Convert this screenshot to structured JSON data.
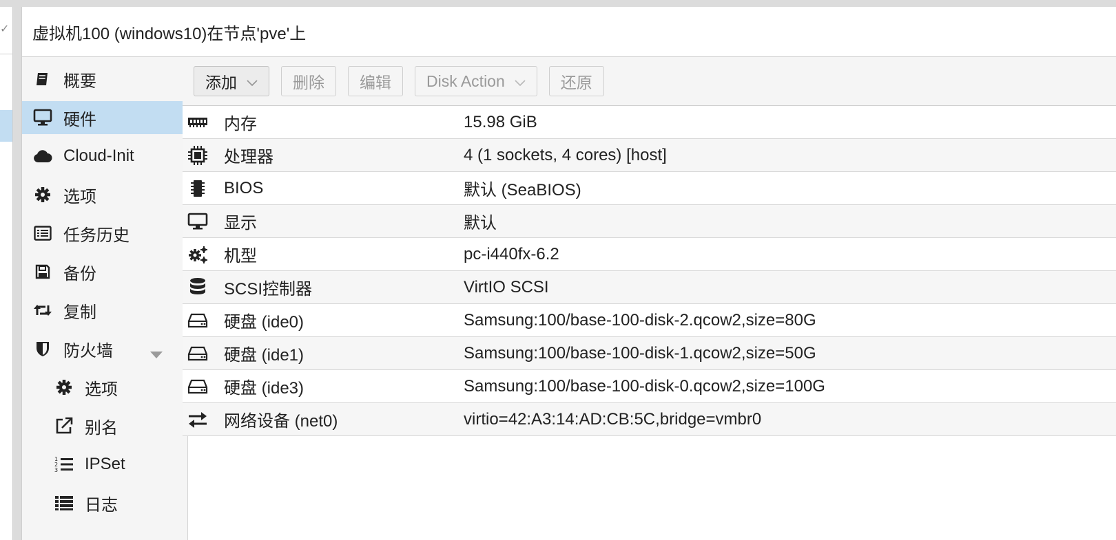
{
  "panel": {
    "title": "虚拟机100 (windows10)在节点'pve'上"
  },
  "nav": {
    "items": [
      {
        "label": "概要",
        "icon": "book-icon"
      },
      {
        "label": "硬件",
        "icon": "desktop-icon",
        "selected": true
      },
      {
        "label": "Cloud-Init",
        "icon": "cloud-icon"
      },
      {
        "label": "选项",
        "icon": "gear-icon"
      },
      {
        "label": "任务历史",
        "icon": "list-alt-icon"
      },
      {
        "label": "备份",
        "icon": "floppy-icon"
      },
      {
        "label": "复制",
        "icon": "retweet-icon"
      },
      {
        "label": "防火墙",
        "icon": "shield-icon",
        "expandable": true
      },
      {
        "label": "选项",
        "icon": "gear-icon",
        "sub": true
      },
      {
        "label": "别名",
        "icon": "external-link-icon",
        "sub": true
      },
      {
        "label": "IPSet",
        "icon": "list-ol-icon",
        "sub": true
      },
      {
        "label": "日志",
        "icon": "list-icon",
        "sub": true
      }
    ]
  },
  "toolbar": {
    "add_label": "添加",
    "remove_label": "删除",
    "edit_label": "编辑",
    "disk_action_label": "Disk Action",
    "revert_label": "还原"
  },
  "hardware": {
    "rows": [
      {
        "name": "内存",
        "value": "15.98 GiB",
        "icon": "memory-icon"
      },
      {
        "name": "处理器",
        "value": "4 (1 sockets, 4 cores) [host]",
        "icon": "cpu-icon"
      },
      {
        "name": "BIOS",
        "value": "默认 (SeaBIOS)",
        "icon": "microchip-icon"
      },
      {
        "name": "显示",
        "value": "默认",
        "icon": "desktop-icon"
      },
      {
        "name": "机型",
        "value": "pc-i440fx-6.2",
        "icon": "cogs-icon"
      },
      {
        "name": "SCSI控制器",
        "value": "VirtIO SCSI",
        "icon": "database-icon"
      },
      {
        "name": "硬盘 (ide0)",
        "value": "Samsung:100/base-100-disk-2.qcow2,size=80G",
        "icon": "hdd-icon"
      },
      {
        "name": "硬盘 (ide1)",
        "value": "Samsung:100/base-100-disk-1.qcow2,size=50G",
        "icon": "hdd-icon"
      },
      {
        "name": "硬盘 (ide3)",
        "value": "Samsung:100/base-100-disk-0.qcow2,size=100G",
        "icon": "hdd-icon"
      },
      {
        "name": "网络设备 (net0)",
        "value": "virtio=42:A3:14:AD:CB:5C,bridge=vmbr0",
        "icon": "exchange-icon"
      }
    ]
  },
  "colors": {
    "selected_bg": "#c2ddf2",
    "nav_bg": "#f5f5f5",
    "border": "#cfcfcf"
  }
}
